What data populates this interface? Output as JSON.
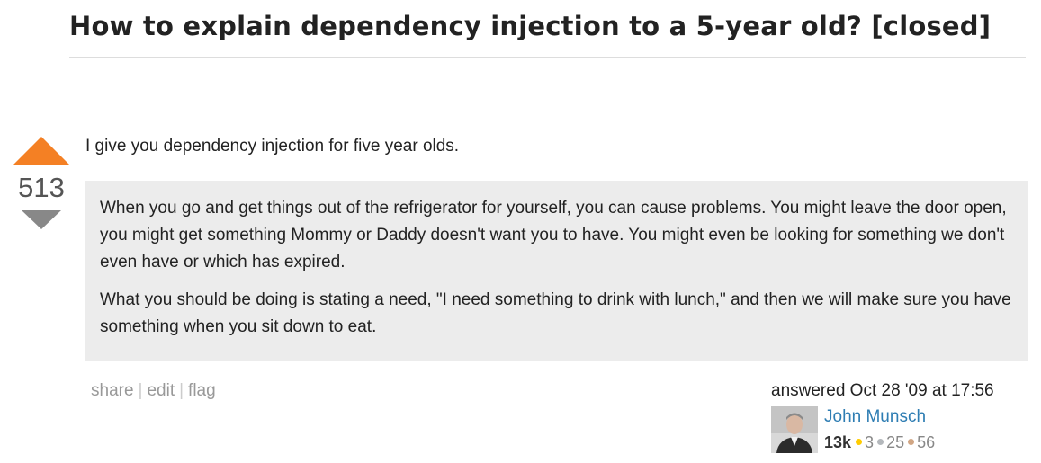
{
  "question": {
    "title": "How to explain dependency injection to a 5-year old? [closed]"
  },
  "answer": {
    "votes": {
      "count": "513",
      "upvote_color": "#f48024",
      "downvote_color": "#888888"
    },
    "intro": "I give you dependency injection for five year olds.",
    "quote": {
      "paragraphs": [
        "When you go and get things out of the refrigerator for yourself, you can cause problems. You might leave the door open, you might get something Mommy or Daddy doesn't want you to have. You might even be looking for something we don't even have or which has expired.",
        "What you should be doing is stating a need, \"I need something to drink with lunch,\" and then we will make sure you have something when you sit down to eat."
      ]
    },
    "menu": {
      "share": "share",
      "edit": "edit",
      "flag": "flag",
      "separator": "|"
    },
    "user": {
      "action_time": "answered Oct 28 '09 at 17:56",
      "name": "John Munsch",
      "reputation": "13k",
      "badges": {
        "gold": "3",
        "silver": "25",
        "bronze": "56"
      },
      "badge_colors": {
        "gold": "#ffcc01",
        "silver": "#b4b8bc",
        "bronze": "#d1a684"
      },
      "avatar_icon": "user-photo"
    }
  }
}
